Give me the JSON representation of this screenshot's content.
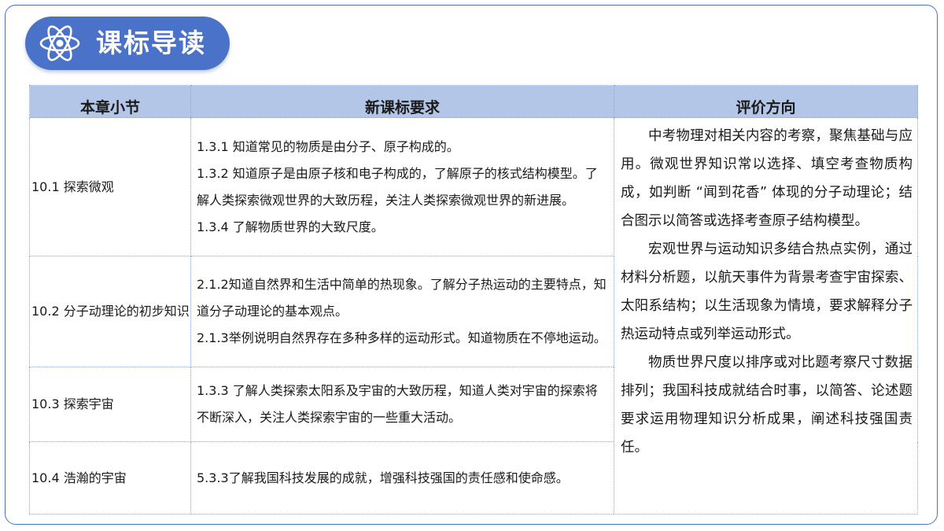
{
  "header": {
    "title": "课标导读",
    "icon": "atom-icon",
    "accent_color": "#4a72c8"
  },
  "table": {
    "header_color": "#b4c6e7",
    "columns": [
      "本章小节",
      "新课标要求",
      "评价方向"
    ],
    "rows": [
      {
        "section": "10.1 探索微观",
        "requirements": [
          "1.3.1 知道常见的物质是由分子、原子构成的。",
          "1.3.2 知道原子是由原子核和电子构成的，了解原子的核式结构模型。了解人类探索微观世界的大致历程，关注人类探索微观世界的新进展。",
          "1.3.4 了解物质世界的大致尺度。"
        ]
      },
      {
        "section": "10.2 分子动理论的初步知识",
        "requirements": [
          "2.1.2知道自然界和生活中简单的热现象。了解分子热运动的主要特点，知道分子动理论的基本观点。",
          "2.1.3举例说明自然界存在多种多样的运动形式。知道物质在不停地运动。"
        ]
      },
      {
        "section": "10.3 探索宇宙",
        "requirements": [
          "1.3.3 了解人类探索太阳系及宇宙的大致历程，知道人类对宇宙的探索将不断深入，关注人类探索宇宙的一些重大活动。"
        ]
      },
      {
        "section": "10.4 浩瀚的宇宙",
        "requirements": [
          "5.3.3了解我国科技发展的成就，增强科技强国的责任感和使命感。"
        ]
      }
    ],
    "evaluation": [
      "中考物理对相关内容的考察，聚焦基础与应用。微观世界知识常以选择、填空考查物质构成，如判断 “闻到花香” 体现的分子动理论；结合图示以简答或选择考查原子结构模型。",
      "宏观世界与运动知识多结合热点实例，通过材料分析题，以航天事件为背景考查宇宙探索、太阳系结构；以生活现象为情境，要求解释分子热运动特点或列举运动形式。",
      "物质世界尺度以排序或对比题考察尺寸数据排列；我国科技成就结合时事，以简答、论述题要求运用物理知识分析成果，阐述科技强国责任。"
    ]
  }
}
